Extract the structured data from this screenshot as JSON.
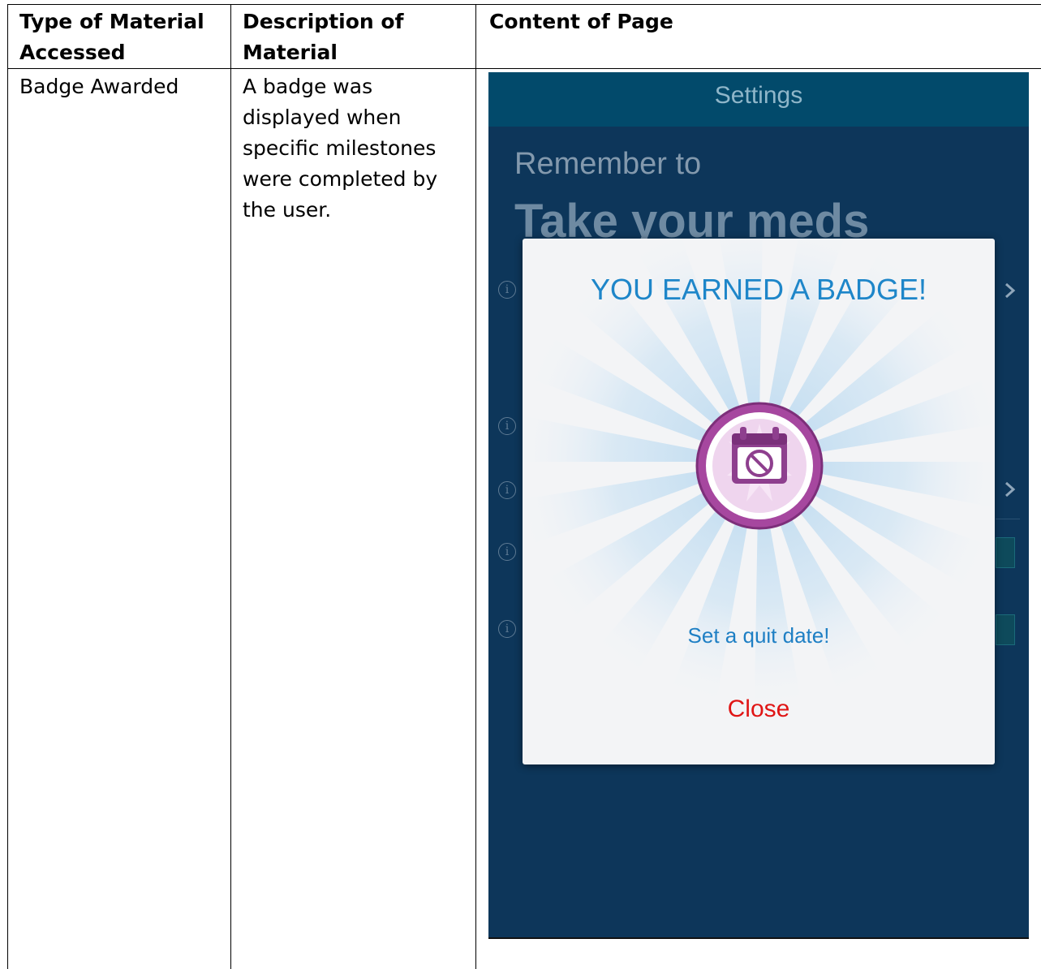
{
  "table": {
    "headers": [
      "Type of Material Accessed",
      "Description of Material",
      "Content of Page"
    ],
    "header_lines": {
      "col1": [
        "Type of Material",
        "Accessed"
      ],
      "col2": [
        "Description of",
        "Material"
      ],
      "col3": [
        "Content of Page"
      ]
    },
    "row": {
      "type": "Badge Awarded",
      "description_lines": [
        "A badge was",
        "displayed when",
        "specific milestones",
        "were completed by",
        "the user."
      ]
    }
  },
  "screen": {
    "appbar_title": "Settings",
    "subtitle": "Remember to",
    "headline": "Take your meds",
    "info_icon": "i",
    "dialog": {
      "title": "YOU EARNED A BADGE!",
      "badge_icon": "calendar-no-icon",
      "message": "Set a quit date!",
      "close_label": "Close"
    }
  },
  "colors": {
    "screen_bg": "#0d365a",
    "appbar_bg": "#024a6b",
    "dialog_title": "#1e86c9",
    "close": "#e01515",
    "badge_purple": "#8e3f8e"
  }
}
